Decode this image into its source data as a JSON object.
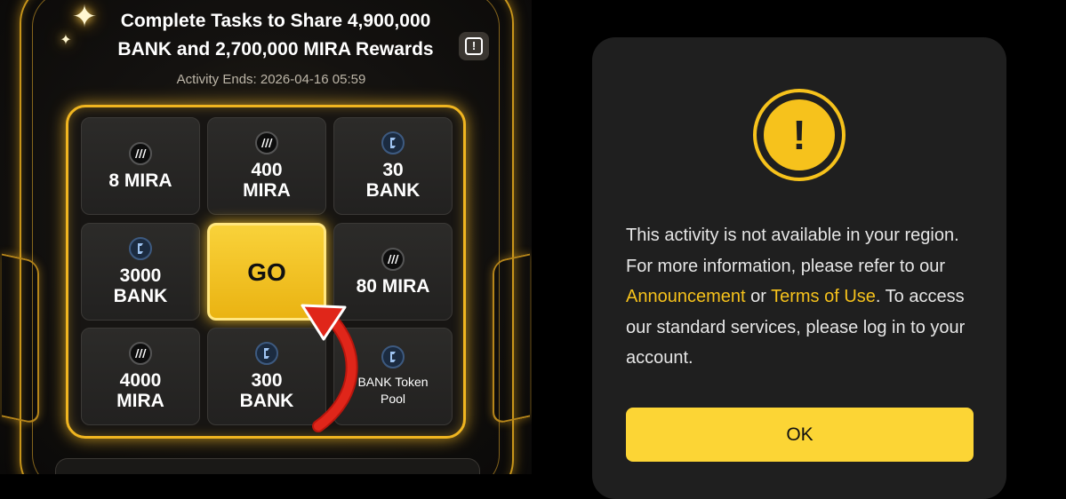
{
  "left": {
    "title_line1": "Complete Tasks to Share 4,900,000",
    "title_line2": "BANK and 2,700,000 MIRA Rewards",
    "activity_ends": "Activity Ends: 2026-04-16 05:59",
    "info_icon": "info-box-icon",
    "cells": [
      {
        "icon": "mira-token-icon",
        "line1": "8 MIRA",
        "line2": ""
      },
      {
        "icon": "mira-token-icon",
        "line1": "400",
        "line2": "MIRA"
      },
      {
        "icon": "bank-token-icon",
        "line1": "30",
        "line2": "BANK"
      },
      {
        "icon": "bank-token-icon",
        "line1": "3000",
        "line2": "BANK"
      },
      {
        "icon": "",
        "line1": "GO",
        "line2": ""
      },
      {
        "icon": "mira-token-icon",
        "line1": "80 MIRA",
        "line2": ""
      },
      {
        "icon": "mira-token-icon",
        "line1": "4000",
        "line2": "MIRA"
      },
      {
        "icon": "bank-token-icon",
        "line1": "300",
        "line2": "BANK"
      },
      {
        "icon": "bank-token-icon",
        "line1": "BANK Token",
        "line2": "Pool"
      }
    ],
    "annotation": "red-arrow-icon"
  },
  "modal": {
    "icon": "warning-icon",
    "exclamation": "!",
    "message_part1": "This activity is not available in your region. For more information, please refer to our ",
    "link_announcement": "Announcement",
    "message_part2": " or ",
    "link_terms": "Terms of Use",
    "message_part3": ". To access our standard services, please log in to your account.",
    "ok_label": "OK"
  },
  "colors": {
    "accent_gold": "#f6c21c",
    "button_yellow": "#fcd535",
    "modal_bg": "#1f1f1f",
    "arrow_red": "#e0261a"
  }
}
